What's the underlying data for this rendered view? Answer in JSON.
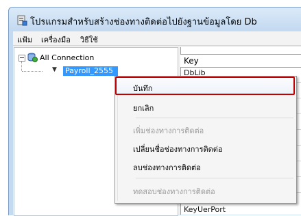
{
  "window": {
    "title": "โปรแกรมสำหรับสร้างช่องทางติดต่อไปยังฐานข้อมูลโดย Db"
  },
  "menubar": {
    "items": [
      {
        "label": "แฟ้ม"
      },
      {
        "label": "เครื่องมือ"
      },
      {
        "label": "วิธีใช้"
      }
    ]
  },
  "tree": {
    "root_label": "All Connection",
    "child_label": "Payroll_2555"
  },
  "grid": {
    "header": "Key",
    "row_partial_top": "DbLib",
    "row_partial_bottom": "KeyUerPort"
  },
  "context_menu": {
    "items": [
      {
        "label": "บันทึก",
        "enabled": true
      },
      {
        "label": "ยกเลิก",
        "enabled": true
      },
      {
        "label": "เพิ่มช่องทางการติดต่อ",
        "enabled": false
      },
      {
        "label": "เปลี่ยนชื่อช่องทางการติดต่อ",
        "enabled": true
      },
      {
        "label": "ลบช่องทางการติดต่อ",
        "enabled": true
      },
      {
        "label": "ทดสอบช่องทางการติดต่อ",
        "enabled": false
      }
    ]
  },
  "icons": {
    "app": "app-icon",
    "db": "database-icon",
    "expander": "tree-collapse-icon"
  },
  "colors": {
    "selection": "#3399ff",
    "highlight_border": "#c00000"
  }
}
